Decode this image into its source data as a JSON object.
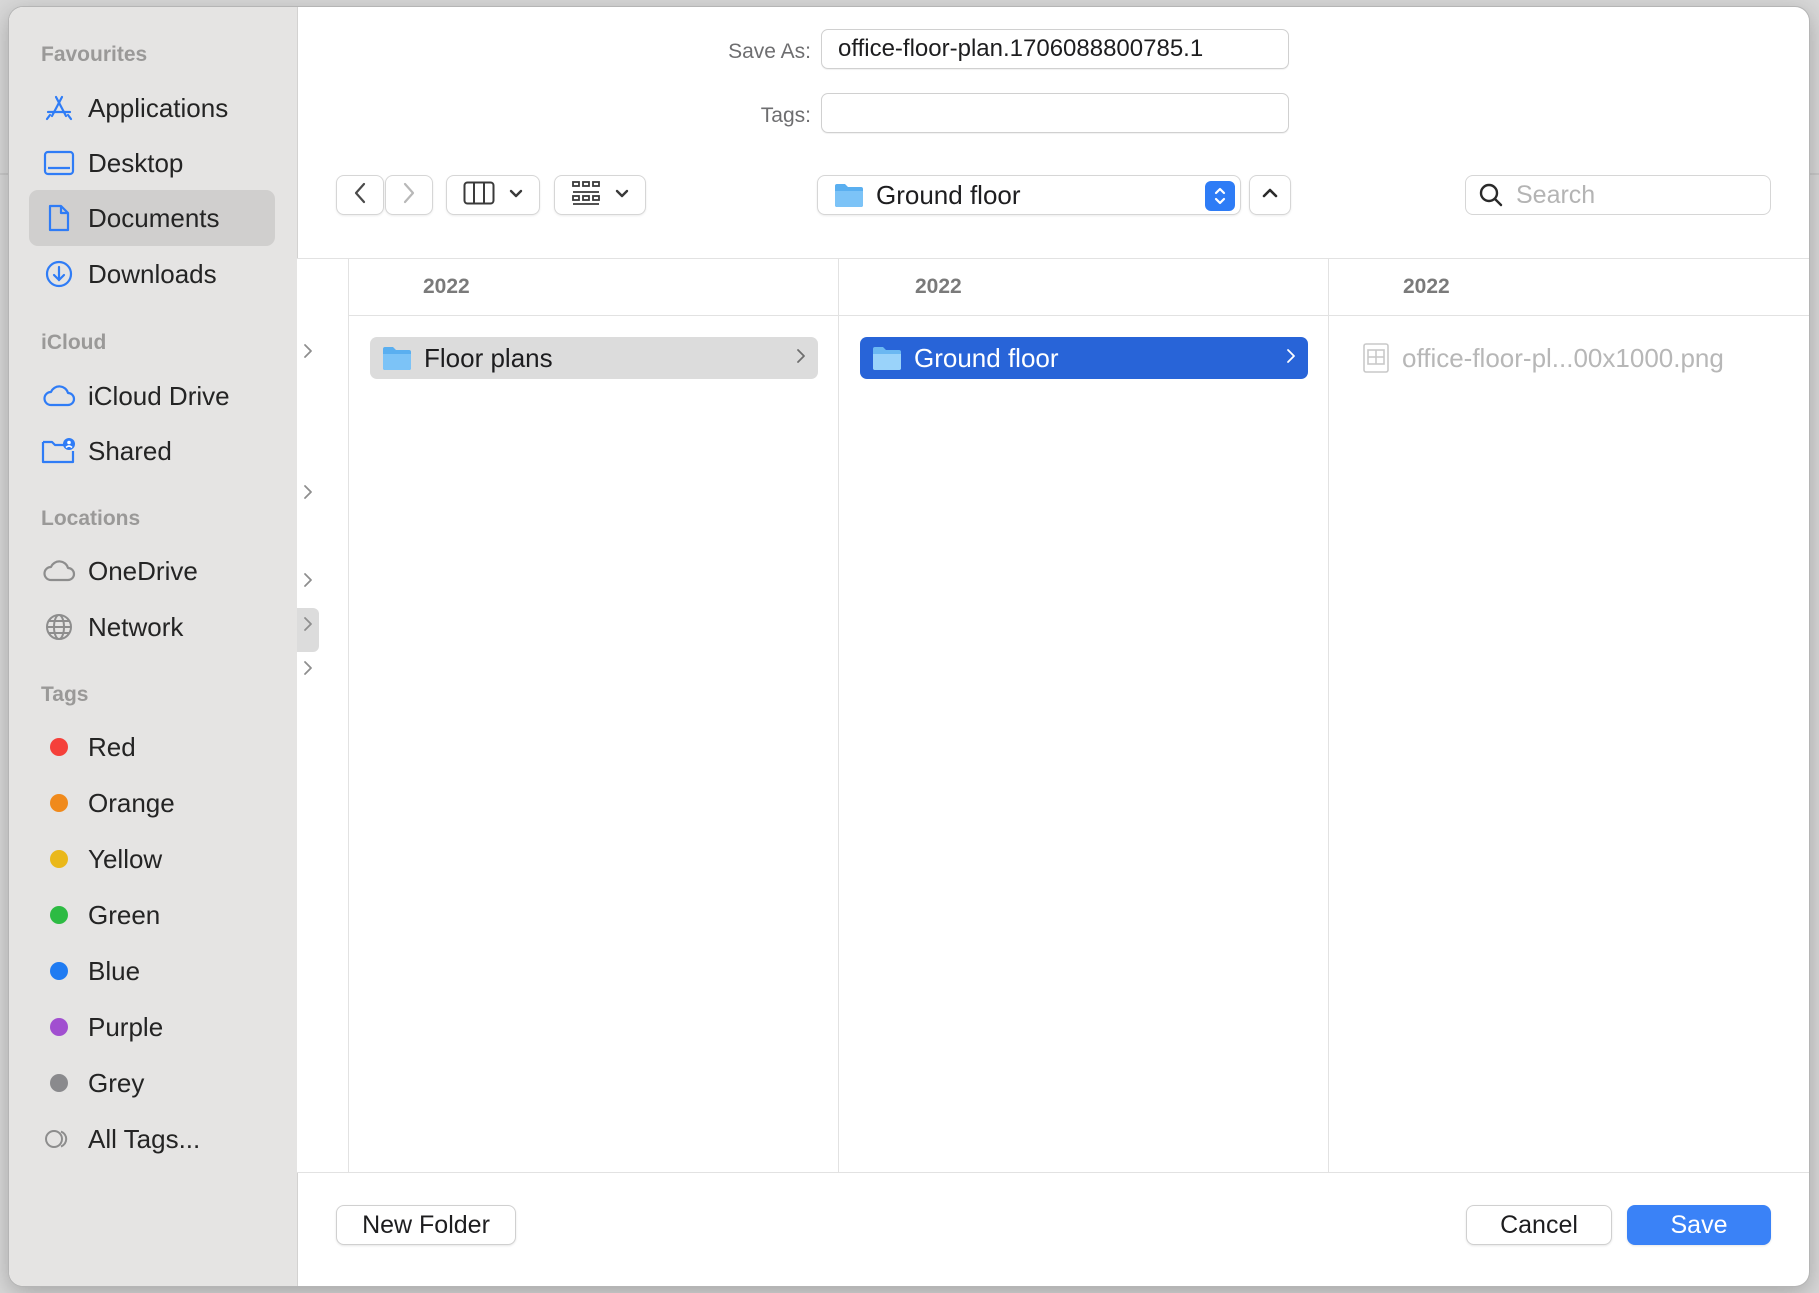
{
  "dialog": {
    "save_as_label": "Save As:",
    "save_as_value": "office-floor-plan.1706088800785.1",
    "tags_label": "Tags:",
    "tags_value": ""
  },
  "sidebar": {
    "sections": [
      {
        "title": "Favourites",
        "items": [
          {
            "label": "Applications",
            "icon": "applications-icon"
          },
          {
            "label": "Desktop",
            "icon": "desktop-icon"
          },
          {
            "label": "Documents",
            "icon": "document-icon",
            "active": true
          },
          {
            "label": "Downloads",
            "icon": "download-icon"
          }
        ]
      },
      {
        "title": "iCloud",
        "items": [
          {
            "label": "iCloud Drive",
            "icon": "cloud-icon"
          },
          {
            "label": "Shared",
            "icon": "shared-folder-icon"
          }
        ]
      },
      {
        "title": "Locations",
        "items": [
          {
            "label": "OneDrive",
            "icon": "cloud-icon"
          },
          {
            "label": "Network",
            "icon": "globe-icon"
          }
        ]
      },
      {
        "title": "Tags",
        "items": [
          {
            "label": "Red",
            "color": "#f5403a"
          },
          {
            "label": "Orange",
            "color": "#f08a1c"
          },
          {
            "label": "Yellow",
            "color": "#eab81a"
          },
          {
            "label": "Green",
            "color": "#2dbb43"
          },
          {
            "label": "Blue",
            "color": "#1f7bf2"
          },
          {
            "label": "Purple",
            "color": "#a14fd0"
          },
          {
            "label": "Grey",
            "color": "#8a8a8d"
          },
          {
            "label": "All Tags...",
            "icon": "all-tags-icon"
          }
        ]
      }
    ]
  },
  "toolbar": {
    "location": "Ground floor",
    "search_placeholder": "Search"
  },
  "browser": {
    "columns": [
      {
        "header": "2022",
        "items": [
          {
            "label": "Floor plans",
            "type": "folder",
            "state": "selected-inactive"
          }
        ]
      },
      {
        "header": "2022",
        "items": [
          {
            "label": "Ground floor",
            "type": "folder",
            "state": "selected"
          }
        ]
      },
      {
        "header": "2022",
        "items": [
          {
            "label": "office-floor-pl...00x1000.png",
            "type": "file",
            "state": "disabled"
          }
        ]
      }
    ]
  },
  "footer": {
    "new_folder": "New Folder",
    "cancel": "Cancel",
    "save": "Save"
  },
  "colors": {
    "accent": "#3a82f7",
    "selection": "#2864d8",
    "sidebar_icon": "#2f7cf6"
  }
}
